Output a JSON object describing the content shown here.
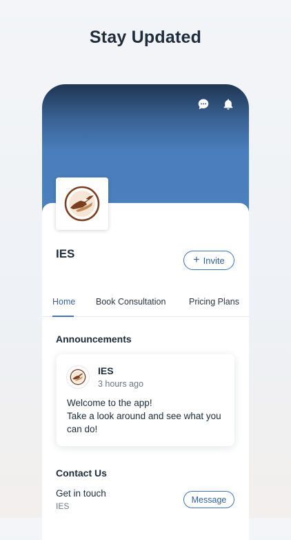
{
  "headline": "Stay Updated",
  "icons": {
    "chat": "chat-bubble-icon",
    "bell": "bell-icon"
  },
  "site": {
    "name": "IES",
    "logo": "ies-logo"
  },
  "invite_button": {
    "label": "Invite",
    "icon": "plus-icon"
  },
  "tabs": [
    {
      "label": "Home",
      "active": true
    },
    {
      "label": "Book Consultation",
      "active": false
    },
    {
      "label": "Pricing Plans",
      "active": false
    }
  ],
  "announcements": {
    "title": "Announcements",
    "post": {
      "author": "IES",
      "time": "3 hours ago",
      "body_lines": [
        "Welcome to the app!",
        "Take a look around and see what you",
        "can do!"
      ]
    }
  },
  "contact": {
    "title": "Contact Us",
    "label": "Get in touch",
    "sub": "IES",
    "button": "Message"
  },
  "colors": {
    "accent": "#3e72b3",
    "cover_top": "#1f3552",
    "cover_bottom": "#4c80bf",
    "logo_brown": "#7a3f1e"
  }
}
